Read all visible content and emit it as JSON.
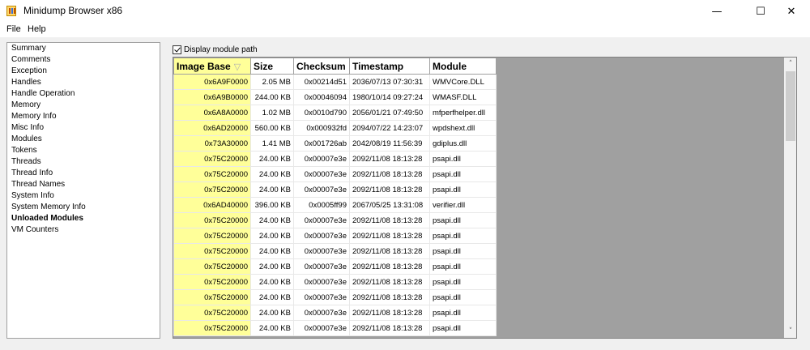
{
  "window": {
    "title": "Minidump Browser x86"
  },
  "window_controls": {
    "minimize": "—",
    "maximize": "☐",
    "close": "✕"
  },
  "menu": [
    "File",
    "Help"
  ],
  "nav": {
    "items": [
      "Summary",
      "Comments",
      "Exception",
      "Handles",
      "Handle Operation",
      "Memory",
      "Memory Info",
      "Misc Info",
      "Modules",
      "Tokens",
      "Threads",
      "Thread Info",
      "Thread Names",
      "System Info",
      "System Memory Info",
      "Unloaded Modules",
      "VM Counters"
    ],
    "active": "Unloaded Modules"
  },
  "options": {
    "display_module_path_label": "Display module path",
    "display_module_path_checked": true
  },
  "grid": {
    "columns": [
      "Image Base",
      "Size",
      "Checksum",
      "Timestamp",
      "Module"
    ],
    "sorted_column": "Image Base",
    "sort_icon": "▽",
    "rows": [
      [
        "0x6A9F0000",
        "2.05 MB",
        "0x00214d51",
        "2036/07/13 07:30:31",
        "WMVCore.DLL"
      ],
      [
        "0x6A9B0000",
        "244.00 KB",
        "0x00046094",
        "1980/10/14 09:27:24",
        "WMASF.DLL"
      ],
      [
        "0x6A8A0000",
        "1.02 MB",
        "0x0010d790",
        "2056/01/21 07:49:50",
        "mfperfhelper.dll"
      ],
      [
        "0x6AD20000",
        "560.00 KB",
        "0x000932fd",
        "2094/07/22 14:23:07",
        "wpdshext.dll"
      ],
      [
        "0x73A30000",
        "1.41 MB",
        "0x001726ab",
        "2042/08/19 11:56:39",
        "gdiplus.dll"
      ],
      [
        "0x75C20000",
        "24.00 KB",
        "0x00007e3e",
        "2092/11/08 18:13:28",
        "psapi.dll"
      ],
      [
        "0x75C20000",
        "24.00 KB",
        "0x00007e3e",
        "2092/11/08 18:13:28",
        "psapi.dll"
      ],
      [
        "0x75C20000",
        "24.00 KB",
        "0x00007e3e",
        "2092/11/08 18:13:28",
        "psapi.dll"
      ],
      [
        "0x6AD40000",
        "396.00 KB",
        "0x0005ff99",
        "2067/05/25 13:31:08",
        "verifier.dll"
      ],
      [
        "0x75C20000",
        "24.00 KB",
        "0x00007e3e",
        "2092/11/08 18:13:28",
        "psapi.dll"
      ],
      [
        "0x75C20000",
        "24.00 KB",
        "0x00007e3e",
        "2092/11/08 18:13:28",
        "psapi.dll"
      ],
      [
        "0x75C20000",
        "24.00 KB",
        "0x00007e3e",
        "2092/11/08 18:13:28",
        "psapi.dll"
      ],
      [
        "0x75C20000",
        "24.00 KB",
        "0x00007e3e",
        "2092/11/08 18:13:28",
        "psapi.dll"
      ],
      [
        "0x75C20000",
        "24.00 KB",
        "0x00007e3e",
        "2092/11/08 18:13:28",
        "psapi.dll"
      ],
      [
        "0x75C20000",
        "24.00 KB",
        "0x00007e3e",
        "2092/11/08 18:13:28",
        "psapi.dll"
      ],
      [
        "0x75C20000",
        "24.00 KB",
        "0x00007e3e",
        "2092/11/08 18:13:28",
        "psapi.dll"
      ],
      [
        "0x75C20000",
        "24.00 KB",
        "0x00007e3e",
        "2092/11/08 18:13:28",
        "psapi.dll"
      ]
    ]
  },
  "scrollbar": {
    "up": "˄",
    "down": "˅"
  },
  "colors": {
    "sorted_highlight": "#ffff99",
    "empty_area": "#a0a0a0"
  }
}
